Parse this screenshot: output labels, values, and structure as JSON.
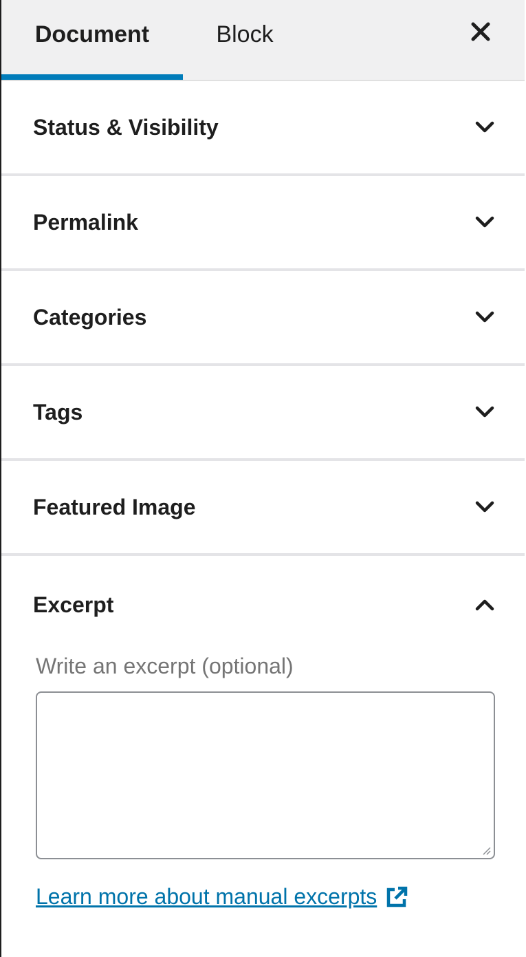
{
  "tabs": {
    "document_label": "Document",
    "block_label": "Block",
    "active": "Document"
  },
  "close_icon": "close-icon",
  "sections": [
    {
      "label": "Status & Visibility",
      "expanded": false,
      "icon": "chevron-down-icon"
    },
    {
      "label": "Permalink",
      "expanded": false,
      "icon": "chevron-down-icon"
    },
    {
      "label": "Categories",
      "expanded": false,
      "icon": "chevron-down-icon"
    },
    {
      "label": "Tags",
      "expanded": false,
      "icon": "chevron-down-icon"
    },
    {
      "label": "Featured Image",
      "expanded": false,
      "icon": "chevron-down-icon"
    }
  ],
  "excerpt": {
    "title": "Excerpt",
    "expanded": true,
    "icon": "chevron-up-icon",
    "field_label": "Write an excerpt (optional)",
    "value": "",
    "learn_more_label": "Learn more about manual excerpts",
    "learn_more_icon": "external-link-icon"
  },
  "colors": {
    "accent": "#007cba",
    "link": "#0073aa",
    "header_bg": "#f0f0f1",
    "divider": "#e4e4e7",
    "text": "#1e1e1e",
    "muted_text": "#757575"
  }
}
